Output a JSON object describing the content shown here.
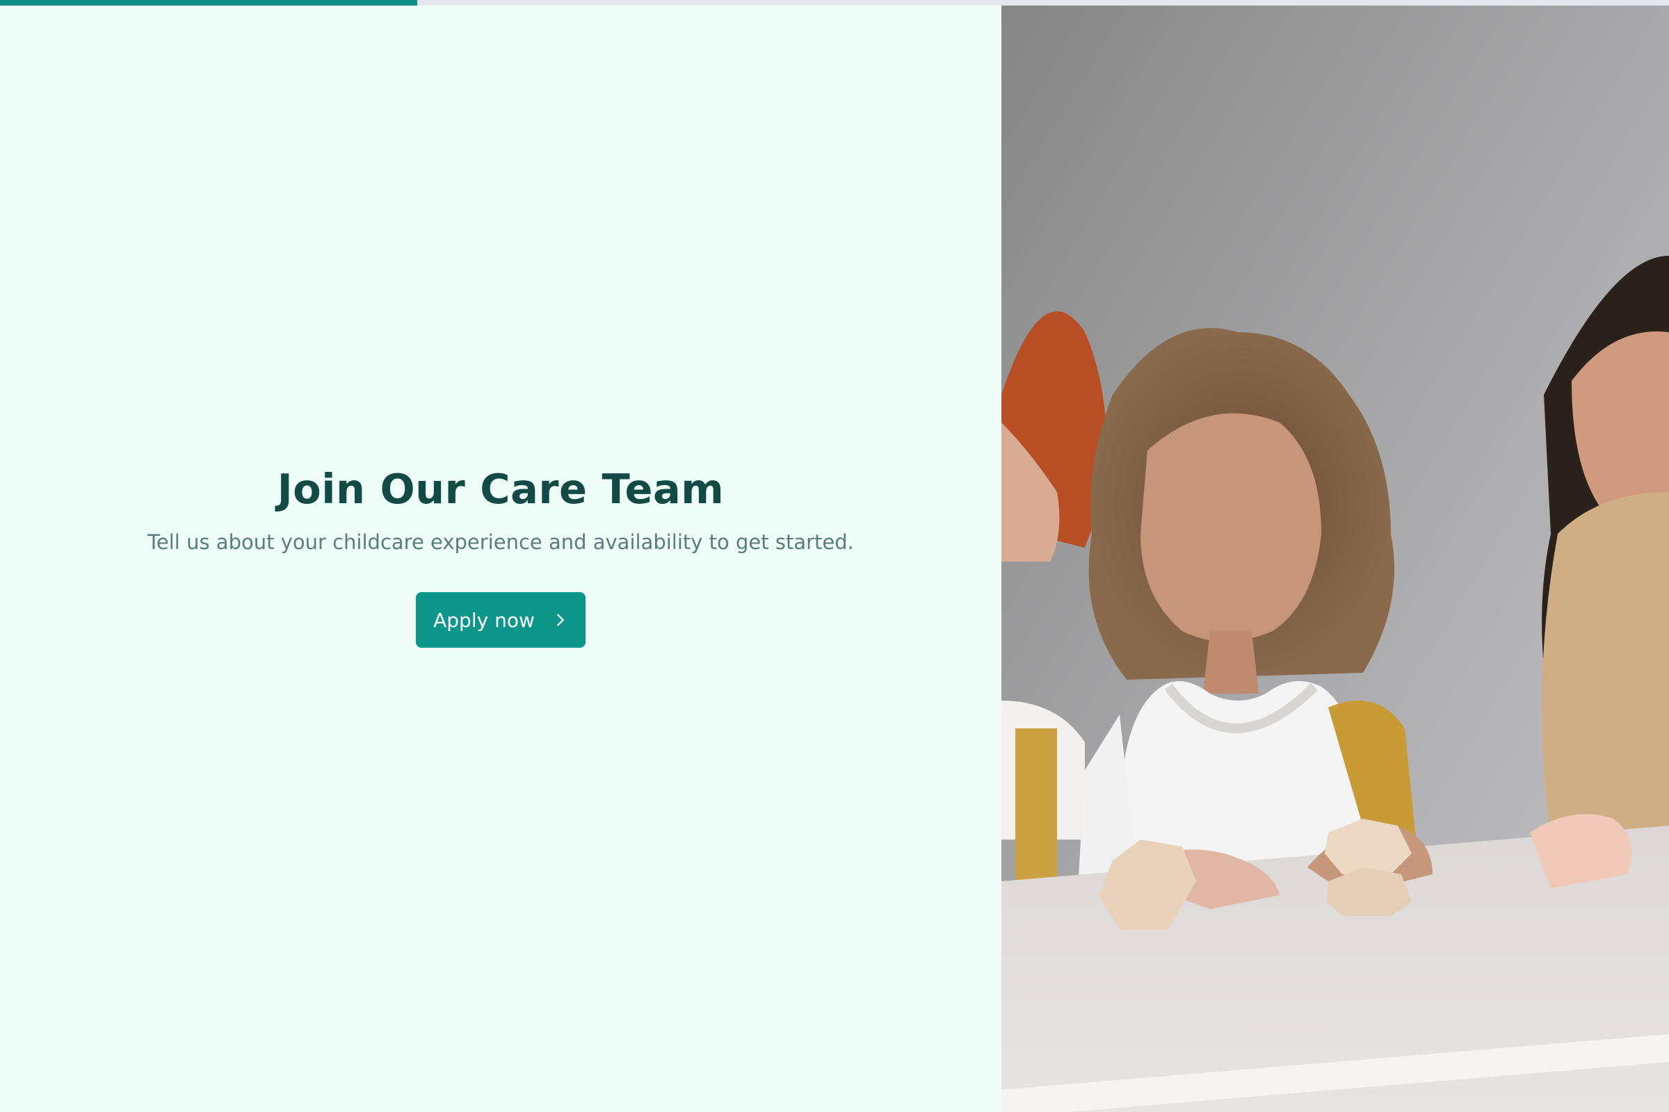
{
  "progress": {
    "fraction": 0.25,
    "color": "#0f8b7f",
    "track_color": "#e4e7eb"
  },
  "hero": {
    "title": "Join Our Care Team",
    "subtitle": "Tell us about your childcare experience and availability to get started.",
    "cta_label": "Apply now",
    "cta_icon": "chevron-right-icon"
  },
  "colors": {
    "background": "#effdf9",
    "title": "#134a45",
    "subtitle": "#5b7c7d",
    "accent": "#0f968a"
  }
}
